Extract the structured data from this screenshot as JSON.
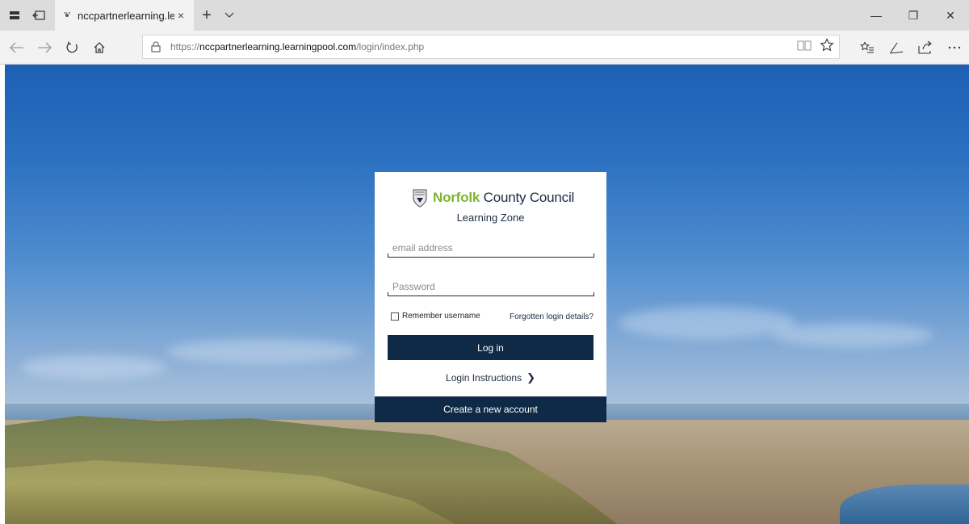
{
  "browser": {
    "tab": {
      "title": "nccpartnerlearning.learn",
      "close": "×"
    },
    "new_tab": "+",
    "tab_list": "﹀",
    "window": {
      "minimize": "—",
      "restore": "❐",
      "close": "✕"
    },
    "address": {
      "scheme": "https://",
      "host": "nccpartnerlearning.learningpool.com",
      "path": "/login/index.php"
    }
  },
  "login": {
    "brand_accent": "Norfolk",
    "brand_rest": " County Council",
    "subtitle": "Learning Zone",
    "email_placeholder": "email address",
    "password_placeholder": "Password",
    "remember_label": "Remember username",
    "forgot_link": "Forgotten login details?",
    "login_button": "Log in",
    "instructions_link": "Login Instructions",
    "instructions_chevron": "❯",
    "create_account": "Create a new account"
  },
  "colors": {
    "accent_green": "#7db42f",
    "navy": "#0e2a47"
  }
}
